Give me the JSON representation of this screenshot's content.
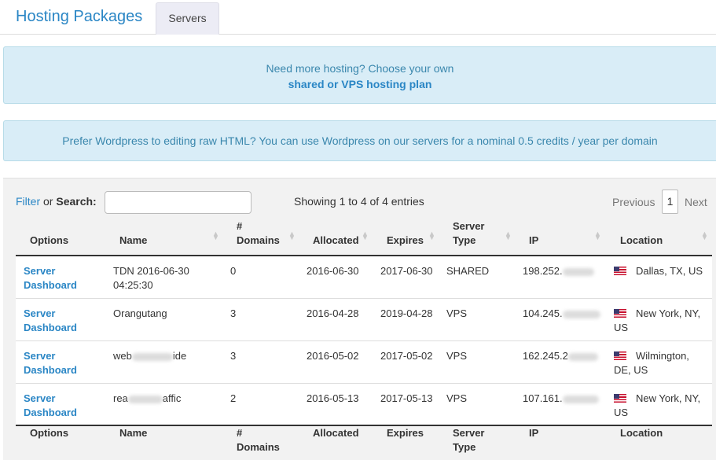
{
  "header": {
    "title": "Hosting Packages",
    "tab": "Servers"
  },
  "alert1": {
    "line1": "Need more hosting? Choose your own",
    "link": "shared or VPS hosting plan"
  },
  "alert2": {
    "text": "Prefer Wordpress to editing raw HTML? You can use Wordpress on our servers for a nominal 0.5 credits / year per domain"
  },
  "table": {
    "filter_link": "Filter",
    "filter_or": "or",
    "search_label": "Search:",
    "search_value": "",
    "showing": "Showing 1 to 4 of 4 entries",
    "pager": {
      "previous": "Previous",
      "page": "1",
      "next": "Next"
    },
    "columns": {
      "options": "Options",
      "name": "Name",
      "domains_1": "#",
      "domains_2": "Domains",
      "allocated": "Allocated",
      "expires": "Expires",
      "type_1": "Server",
      "type_2": "Type",
      "ip": "IP",
      "location": "Location"
    },
    "rows": [
      {
        "option_1": "Server",
        "option_2": "Dashboard",
        "name_1": "TDN 2016-06-30",
        "name_2": "04:25:30",
        "domains": "0",
        "allocated": "2016-06-30",
        "expires": "2017-06-30",
        "type": "SHARED",
        "ip": "198.252.",
        "loc_1": "Dallas, TX, US",
        "loc_2": ""
      },
      {
        "option_1": "Server",
        "option_2": "Dashboard",
        "name_1": "Orangutang",
        "name_2": "",
        "domains": "3",
        "allocated": "2016-04-28",
        "expires": "2019-04-28",
        "type": "VPS",
        "ip": "104.245.",
        "loc_1": "New York, NY,",
        "loc_2": "US"
      },
      {
        "option_1": "Server",
        "option_2": "Dashboard",
        "name_pre": "web",
        "name_post": "ide",
        "domains": "3",
        "allocated": "2016-05-02",
        "expires": "2017-05-02",
        "type": "VPS",
        "ip": "162.245.2",
        "loc_1": "Wilmington,",
        "loc_2": "DE, US"
      },
      {
        "option_1": "Server",
        "option_2": "Dashboard",
        "name_pre": "rea",
        "name_post": "affic",
        "domains": "2",
        "allocated": "2016-05-13",
        "expires": "2017-05-13",
        "type": "VPS",
        "ip": "107.161.",
        "loc_1": "New York, NY,",
        "loc_2": "US"
      }
    ]
  }
}
